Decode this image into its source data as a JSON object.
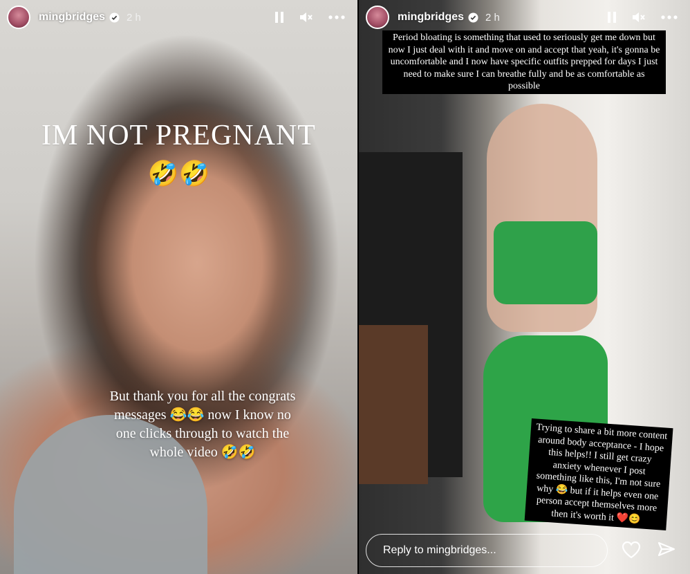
{
  "left_story": {
    "username": "mingbridges",
    "time": "2 h",
    "headline": "IM NOT PREGNANT",
    "headline_emoji": "🤣🤣",
    "caption": "But thank you for all the congrats messages 😂😂 now I know no one clicks through to watch the whole video 🤣🤣"
  },
  "right_story": {
    "username": "mingbridges",
    "time": "2 h",
    "caption_top": "Period bloating is something that used to seriously get me down but now I just deal with it and move on and accept that yeah, it's gonna be uncomfortable and I now have specific outfits prepped for days I just need to make sure I can breathe fully and be as comfortable as possible",
    "caption_bottom": "Trying to share a bit more content around body acceptance - I hope this helps!! I still get crazy anxiety whenever I post something like this, I'm not sure why 😂 but if it helps even one person accept themselves more then it's worth it ❤️😊",
    "reply_placeholder": "Reply to mingbridges..."
  },
  "icons": {
    "verified": "verified-badge-icon",
    "pause": "pause-icon",
    "mute": "mute-icon",
    "more": "more-icon",
    "like": "heart-icon",
    "share": "send-icon"
  }
}
